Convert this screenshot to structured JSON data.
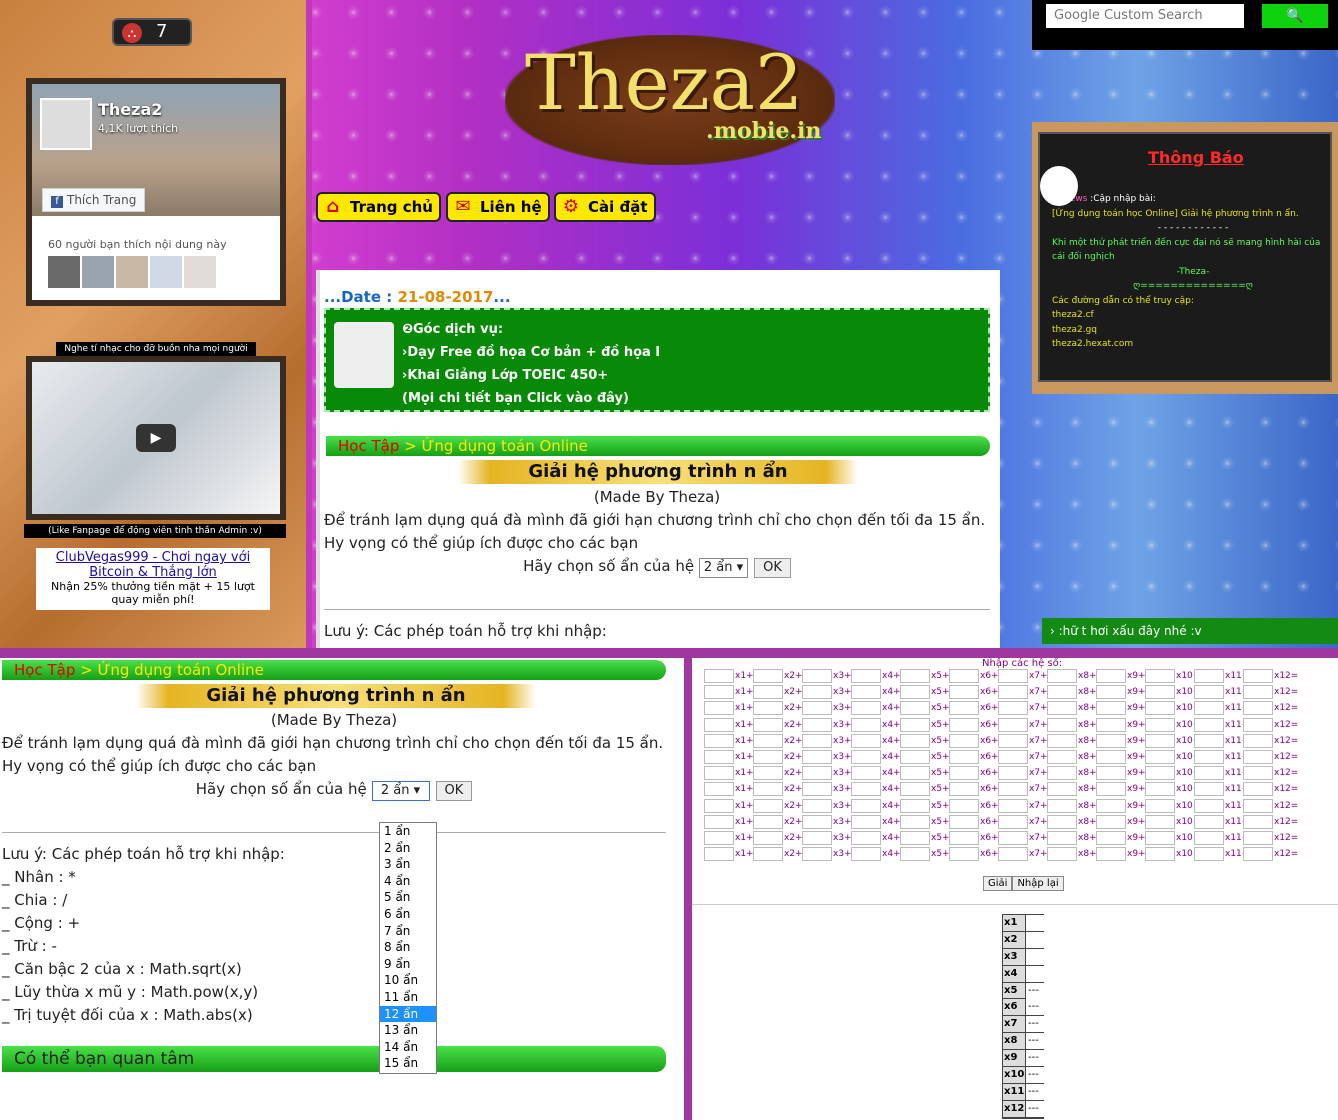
{
  "counter": {
    "value": "7"
  },
  "facebook": {
    "name": "Theza2",
    "likes": "4,1K lượt thích",
    "like_btn": "Thích Trang",
    "friends_text": "60 người bạn thích nội dung này"
  },
  "left": {
    "music_label": "Nghe tí nhạc cho đỡ buồn nha mọi người",
    "fanpage_label": "(Like Fanpage để động viên tinh thần Admin :v)",
    "ad_title": "ClubVegas999 - Chơi ngay với Bitcoin & Thắng lớn",
    "ad_text": "Nhận 25% thưởng tiền mặt + 15 lượt quay miễn phí!"
  },
  "logo": {
    "main": "Theza2",
    "sub": ".mobie.in"
  },
  "menu": {
    "home": "Trang chủ",
    "contact": "Liên hệ",
    "settings": "Cài đặt"
  },
  "date": {
    "prefix": "...Date :",
    "value": "21-08-2017",
    "suffix": "..."
  },
  "service": {
    "title": "❷Góc dịch vụ:",
    "line1": "›Dạy Free đồ họa Cơ bản + đồ họa I",
    "line2": "›Khai Giảng Lớp TOEIC 450+",
    "line3": "(Mọi chi tiết bạn Click vào đây)"
  },
  "breadcrumb": {
    "root": "Học Tập",
    "sep": " > ",
    "page": "Ứng dụng toán Online"
  },
  "calc": {
    "title": "Giải hệ phương trình n ẩn",
    "author": "(Made By Theza)",
    "desc1": "Để tránh lạm dụng quá đà mình đã giới hạn chương trình chỉ cho chọn đến tối đa 15 ẩn.",
    "desc2": "Hy vọng có thể giúp ích được cho các bạn",
    "choose": "Hãy chọn số ẩn của hệ",
    "selected": "2 ẩn",
    "ok": "OK",
    "note": "Lưu ý: Các phép toán hỗ trợ khi nhập:",
    "ops": [
      "_ Nhân : *",
      "_ Chia : /",
      "_ Cộng : +",
      "_ Trừ : -",
      "_ Căn bậc 2 của x : Math.sqrt(x)",
      "_ Lũy thừa x mũ y : Math.pow(x,y)",
      "_ Trị tuyệt đối của x : Math.abs(x)"
    ],
    "related": "Có thể bạn quan tâm",
    "options": [
      "1 ẩn",
      "2 ẩn",
      "3 ẩn",
      "4 ẩn",
      "5 ẩn",
      "6 ẩn",
      "7 ẩn",
      "8 ẩn",
      "9 ẩn",
      "10 ẩn",
      "11 ẩn",
      "12 ẩn",
      "13 ẩn",
      "14 ẩn",
      "15 ẩn"
    ],
    "highlighted_option": "12 ẩn"
  },
  "search": {
    "placeholder": "Google Custom Search",
    "btn": "🔍"
  },
  "notice": {
    "title": "Thông Báo",
    "news_label": "News",
    "news_text": ":Cập nhập bài:",
    "item": "[Ứng dụng toán học Online] Giải hệ phương trình n ẩn.",
    "dashes": "- - - - - - - - - - - -",
    "quote": "Khi một thứ phát triển đến cực đại nó sẽ mang hình hài của cái đối nghịch",
    "sign": "-Theza-",
    "sep2": "ღ==============ღ",
    "links_title": "Các đường dẫn có thể truy cập:",
    "links": [
      "theza2.cf",
      "theza2.gq",
      "theza2.hexat.com"
    ]
  },
  "marquee": {
    "text": "› :hữ t hơi xấu đây nhé :v"
  },
  "grid": {
    "title": "Nhập các hệ số:",
    "labels": [
      "x1+",
      "x2+",
      "x3+",
      "x4+",
      "x5+",
      "x6+",
      "x7+",
      "x8+",
      "x9+",
      "x10+",
      "x11+",
      "x12="
    ],
    "solve": "Giải",
    "reset": "Nhập lại",
    "results": [
      {
        "var": "x1",
        "val": ""
      },
      {
        "var": "x2",
        "val": ""
      },
      {
        "var": "x3",
        "val": ""
      },
      {
        "var": "x4",
        "val": ""
      },
      {
        "var": "x5",
        "val": "---"
      },
      {
        "var": "x6",
        "val": "---"
      },
      {
        "var": "x7",
        "val": "---"
      },
      {
        "var": "x8",
        "val": "---"
      },
      {
        "var": "x9",
        "val": "---"
      },
      {
        "var": "x10",
        "val": "---"
      },
      {
        "var": "x11",
        "val": "---"
      },
      {
        "var": "x12",
        "val": "---"
      }
    ]
  }
}
